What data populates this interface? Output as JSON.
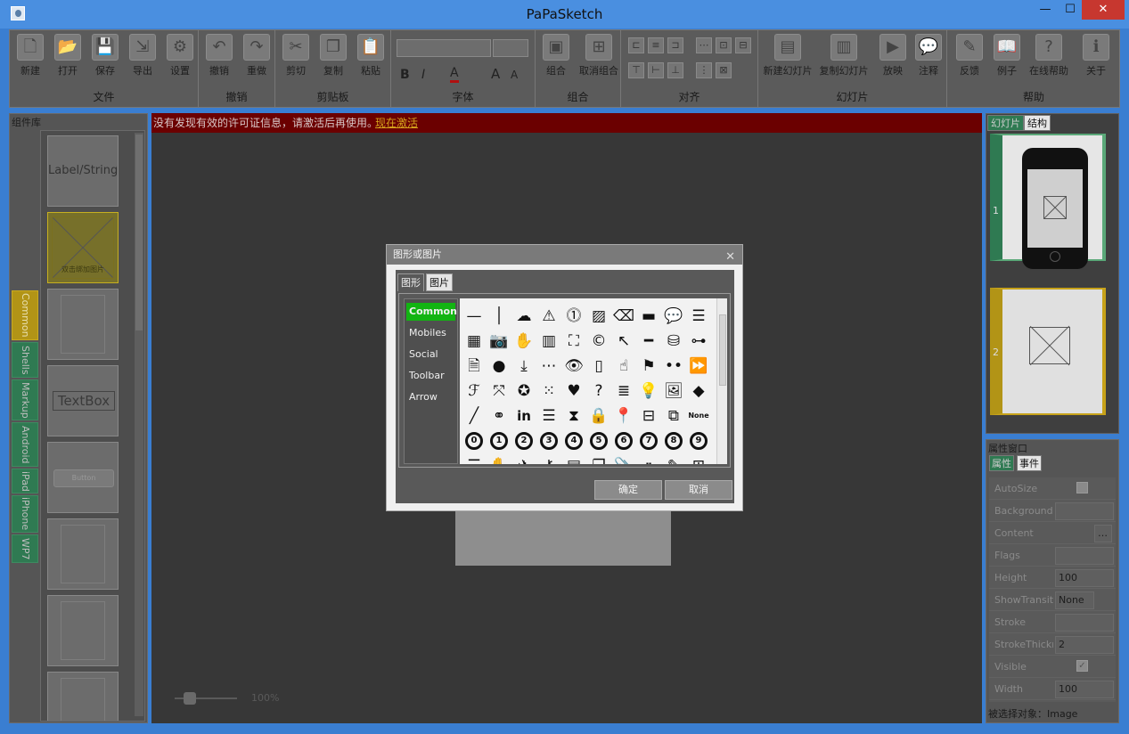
{
  "window": {
    "title": "PaPaSketch"
  },
  "ribbon": {
    "groups": [
      {
        "label": "文件",
        "buttons": [
          "新建",
          "打开",
          "保存",
          "导出",
          "设置"
        ]
      },
      {
        "label": "撤销",
        "buttons": [
          "撤销",
          "重做"
        ]
      },
      {
        "label": "剪贴板",
        "buttons": [
          "剪切",
          "复制",
          "粘贴"
        ]
      },
      {
        "label": "字体"
      },
      {
        "label": "组合",
        "buttons": [
          "组合",
          "取消组合"
        ]
      },
      {
        "label": "对齐"
      },
      {
        "label": "幻灯片",
        "buttons": [
          "新建幻灯片",
          "复制幻灯片",
          "放映",
          "注释"
        ]
      },
      {
        "label": "帮助",
        "buttons": [
          "反馈",
          "例子",
          "在线帮助",
          "关于"
        ]
      }
    ],
    "font_buttons": [
      "B",
      "I",
      "A",
      "A",
      "A"
    ]
  },
  "library": {
    "title": "组件库",
    "items": [
      "Label/String",
      "双击绑加图片",
      "",
      "TextBox",
      "Button",
      "",
      ""
    ],
    "tabs": [
      "Common",
      "Shells",
      "Markup",
      "Android",
      "iPad",
      "iPhone",
      "WP7"
    ]
  },
  "canvas": {
    "license_text": "没有发现有效的许可证信息，请激活后再使用。",
    "activate_link": "现在激活",
    "zoom": "100%"
  },
  "slides": {
    "tabs": [
      "幻灯片",
      "结构"
    ],
    "numbers": [
      "1",
      "2"
    ]
  },
  "props": {
    "title": "属性窗口",
    "tabs": [
      "属性",
      "事件"
    ],
    "rows": [
      {
        "name": "AutoSize",
        "value": ""
      },
      {
        "name": "Background",
        "value": ""
      },
      {
        "name": "Content",
        "value": ""
      },
      {
        "name": "Flags",
        "value": ""
      },
      {
        "name": "Height",
        "value": "100"
      },
      {
        "name": "ShowTransit",
        "value": "None"
      },
      {
        "name": "Stroke",
        "value": ""
      },
      {
        "name": "StrokeThickr",
        "value": "2"
      },
      {
        "name": "Visible",
        "value": "✓"
      },
      {
        "name": "Width",
        "value": "100"
      }
    ],
    "status": "被选择对象：Image"
  },
  "dialog": {
    "title": "图形或图片",
    "tabs": [
      "图形",
      "图片"
    ],
    "categories": [
      "Common",
      "Mobiles",
      "Social",
      "Toolbar",
      "Arrow"
    ],
    "circle_numbers": [
      "0",
      "1",
      "2",
      "3",
      "4",
      "5",
      "6",
      "7",
      "8",
      "9"
    ],
    "none_label": "None",
    "ok": "确定",
    "cancel": "取消"
  }
}
